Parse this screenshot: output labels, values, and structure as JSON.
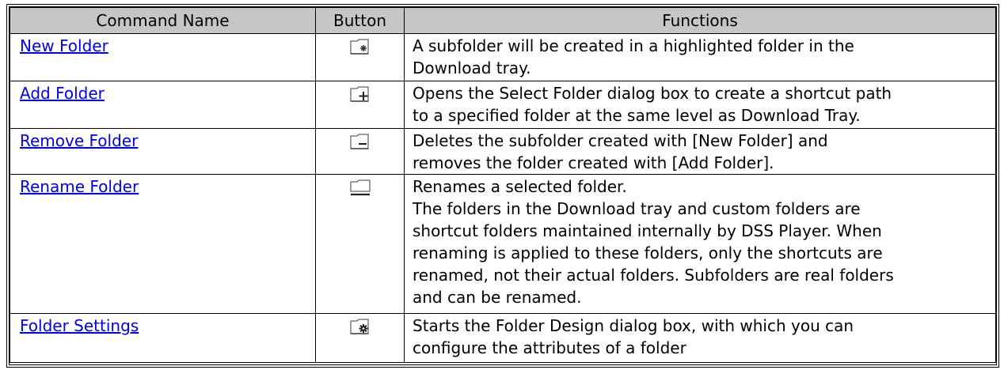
{
  "table": {
    "headers": {
      "command": "Command Name",
      "button": "Button",
      "functions": "Functions"
    },
    "rows": [
      {
        "name": "New Folder",
        "icon": "new-folder-icon",
        "func": [
          "A subfolder will be created in a highlighted folder in the",
          "Download tray."
        ]
      },
      {
        "name": "Add Folder",
        "icon": "add-folder-icon",
        "func": [
          "Opens the Select Folder dialog box to create a shortcut path",
          "to a specified folder at the same level as Download Tray."
        ]
      },
      {
        "name": "Remove Folder",
        "icon": "remove-folder-icon",
        "func": [
          "Deletes the subfolder created with [New Folder] and",
          "removes the folder created with [Add Folder]."
        ]
      },
      {
        "name": "Rename Folder",
        "icon": "rename-folder-icon",
        "func": [
          "Renames a selected folder.",
          "The folders in the Download tray and custom folders are",
          "shortcut folders maintained internally by DSS Player. When",
          "renaming is applied to these folders, only the shortcuts are",
          "renamed, not their actual folders. Subfolders are real folders",
          "and can be renamed."
        ]
      },
      {
        "name": "Folder Settings",
        "icon": "folder-settings-icon",
        "func": [
          "Starts the Folder Design dialog box, with which you can",
          "configure the attributes of a folder"
        ]
      }
    ]
  },
  "colors": {
    "header_bg": "#c6c6c6",
    "link": "#0000ee",
    "border": "#000000"
  }
}
